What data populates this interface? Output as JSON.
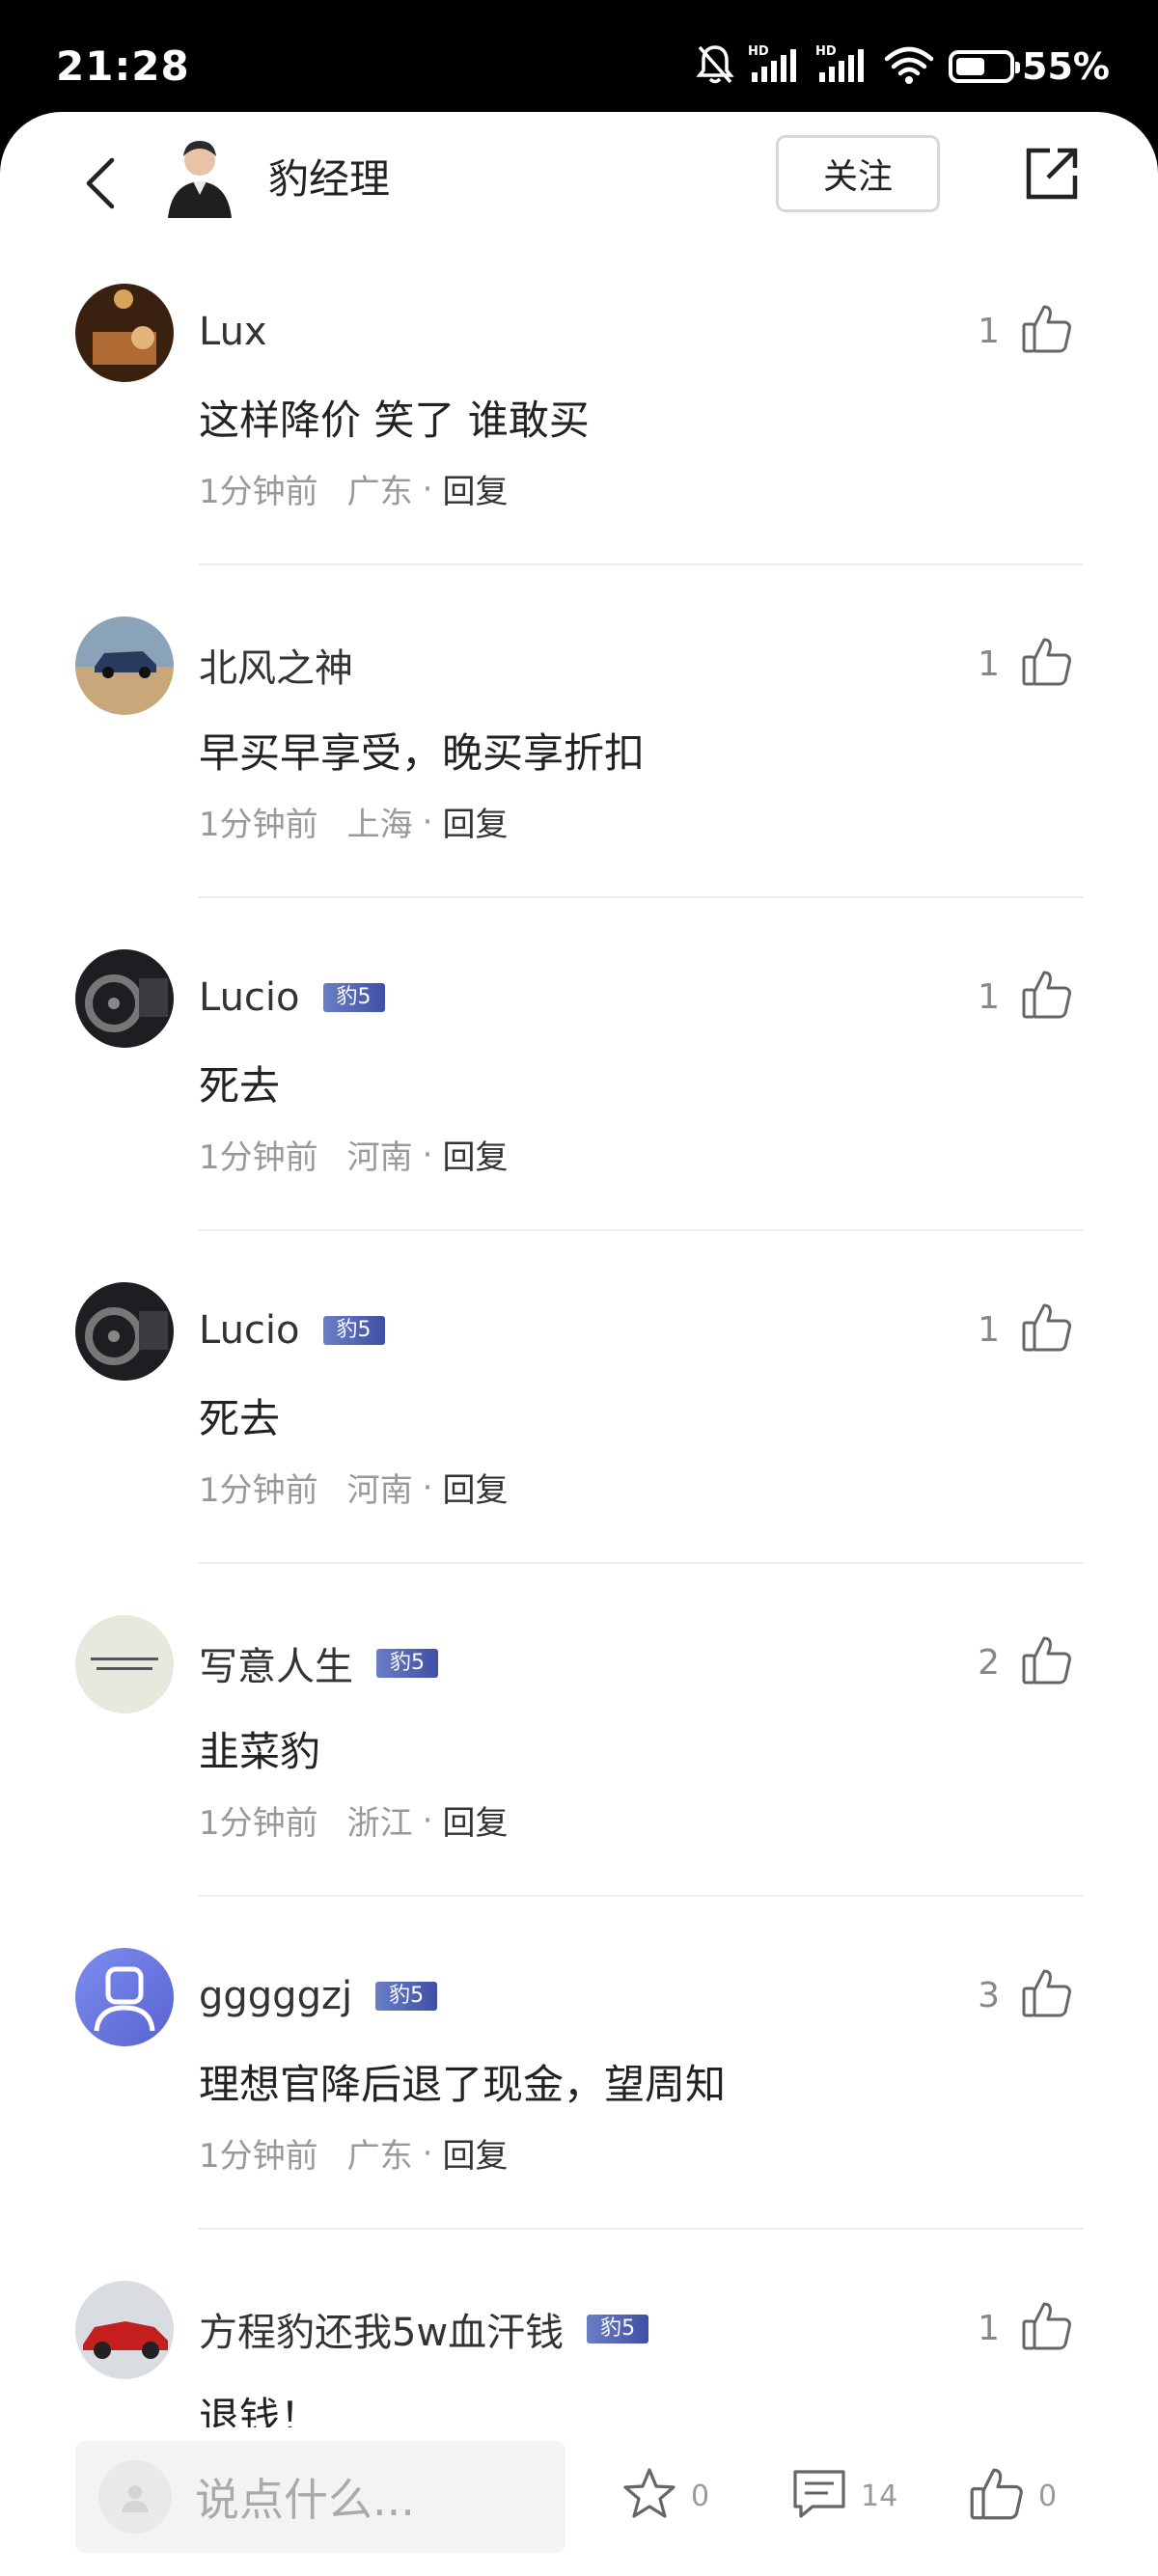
{
  "status_bar": {
    "time": "21:28",
    "battery_text": "55%",
    "battery_level": 0.55,
    "icons": [
      "mute-bell-icon",
      "hd-signal-icon",
      "hd-signal-icon",
      "wifi-icon",
      "battery-icon"
    ]
  },
  "header": {
    "author_name": "豹经理",
    "follow_label": "关注",
    "icons": [
      "back-icon",
      "share-icon"
    ]
  },
  "comments": [
    {
      "name": "Lux",
      "badge": "",
      "text": "这样降价 笑了 谁敢买",
      "time": "1分钟前",
      "location": "广东",
      "reply": "回复",
      "likes": "1",
      "avatar_color": "#6b3b1a"
    },
    {
      "name": "北风之神",
      "badge": "",
      "text": "早买早享受，晚买享折扣",
      "time": "1分钟前",
      "location": "上海",
      "reply": "回复",
      "likes": "1",
      "avatar_color": "#b9a58a"
    },
    {
      "name": "Lucio",
      "badge": "豹5",
      "text": "死去",
      "time": "1分钟前",
      "location": "河南",
      "reply": "回复",
      "likes": "1",
      "avatar_color": "#2a2a2e"
    },
    {
      "name": "Lucio",
      "badge": "豹5",
      "text": "死去",
      "time": "1分钟前",
      "location": "河南",
      "reply": "回复",
      "likes": "1",
      "avatar_color": "#2a2a2e"
    },
    {
      "name": "写意人生",
      "badge": "豹5",
      "text": "韭菜豹",
      "time": "1分钟前",
      "location": "浙江",
      "reply": "回复",
      "likes": "2",
      "avatar_color": "#e6e6dc"
    },
    {
      "name": "gggggzj",
      "badge": "豹5",
      "text": "理想官降后退了现金，望周知",
      "time": "1分钟前",
      "location": "广东",
      "reply": "回复",
      "likes": "3",
      "avatar_color": "#6f7fe0"
    },
    {
      "name": "方程豹还我5w血汗钱",
      "badge": "豹5",
      "text": "退钱！",
      "time": "",
      "location": "",
      "reply": "",
      "likes": "1",
      "avatar_color": "#c02626"
    }
  ],
  "bottom_bar": {
    "input_placeholder": "说点什么...",
    "favorite_count": "0",
    "comment_count": "14",
    "like_count": "0"
  },
  "colors": {
    "badge": "#4f5fb4",
    "reply_text": "#333333",
    "meta_text": "#999999"
  }
}
